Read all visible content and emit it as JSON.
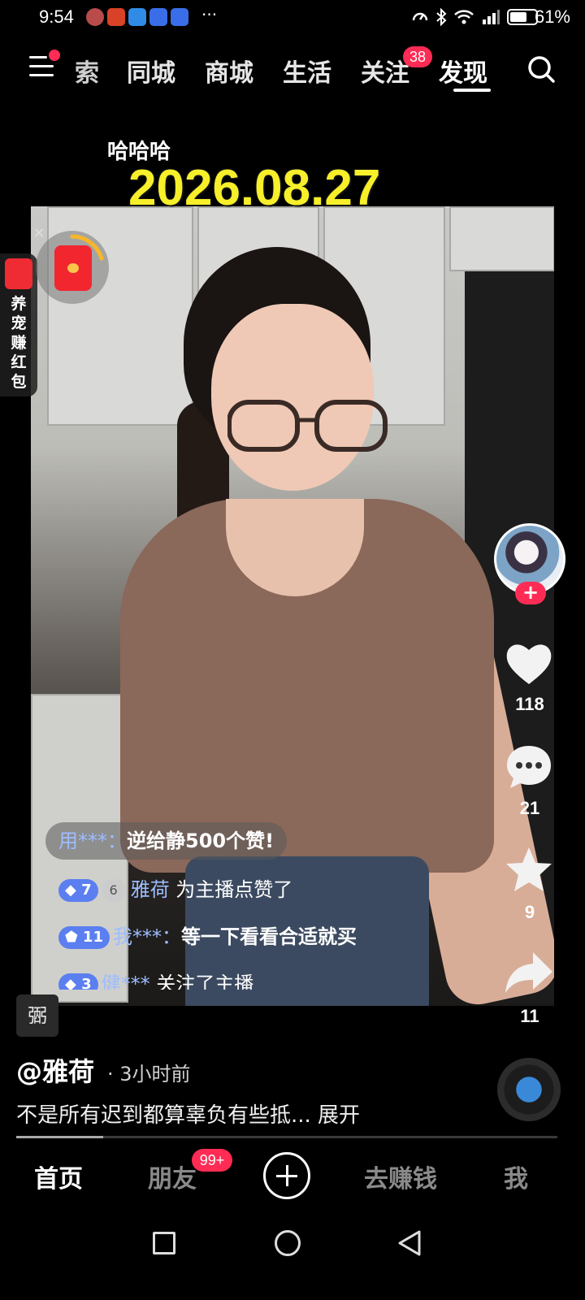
{
  "status_bar": {
    "time": "9:54",
    "more": "···",
    "battery_percent": "61%"
  },
  "top_nav": {
    "tabs": [
      {
        "label": "索"
      },
      {
        "label": "同城"
      },
      {
        "label": "商城"
      },
      {
        "label": "生活"
      },
      {
        "label": "关注"
      },
      {
        "label": "发现"
      }
    ],
    "follow_badge": "38",
    "active_tab": "发现"
  },
  "video": {
    "caption_small": "哈哈哈",
    "caption_date": "2026.08.27"
  },
  "red_packet": {
    "close": "✕",
    "side_tab_text": "养宠赚红包"
  },
  "comments": [
    {
      "user": "用***：",
      "text": "逆给静500个赞!"
    },
    {
      "level": "7",
      "level2": "6",
      "user": "雅荷",
      "text": "为主播点赞了"
    },
    {
      "level": "11",
      "user": "我***：",
      "text": "等一下看看合适就买"
    },
    {
      "level": "3",
      "user": "健***",
      "text": "关注了主播"
    }
  ],
  "right_rail": {
    "follow_plus": "+",
    "likes": "118",
    "comments": "21",
    "favorites": "9",
    "shares": "11"
  },
  "post": {
    "tag": "弻",
    "author": "@雅荷",
    "time_ago": "· 3小时前",
    "description": "不是所有迟到都算辜负有些抵... 展开",
    "progress": 0.16
  },
  "bottom_nav": {
    "home": "首页",
    "friends": "朋友",
    "friends_badge": "99+",
    "earn": "去赚钱",
    "me": "我"
  },
  "colors": {
    "accent_red": "#fe2c55",
    "caption_yellow": "#f7ef2a",
    "level_blue": "#5b7ff0"
  }
}
